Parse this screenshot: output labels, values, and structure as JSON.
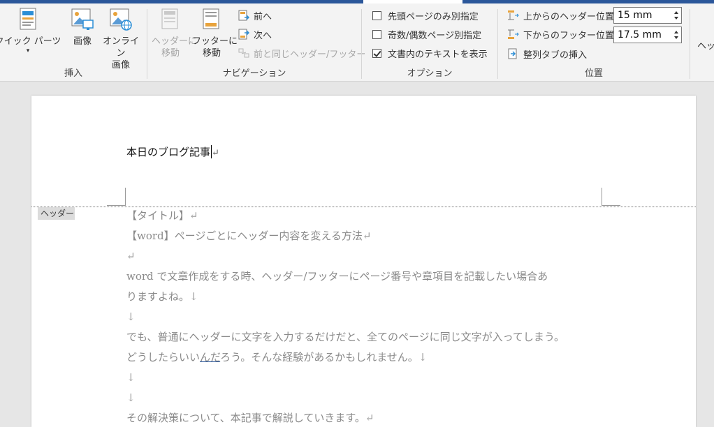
{
  "ribbon": {
    "insert_group": {
      "label": "挿入",
      "quick_parts": "クイック パーツ",
      "quick_parts_arrow": "▾",
      "picture": "画像",
      "online_picture_line1": "オンライン",
      "online_picture_line2": "画像"
    },
    "navigation_group": {
      "label": "ナビゲーション",
      "goto_header_line1": "ヘッダーに",
      "goto_header_line2": "移動",
      "goto_footer_line1": "フッターに",
      "goto_footer_line2": "移動",
      "previous": "前へ",
      "next": "次へ",
      "link_to_previous": "前と同じヘッダー/フッター"
    },
    "options_group": {
      "label": "オプション",
      "different_first_page": "先頭ページのみ別指定",
      "different_first_page_checked": false,
      "different_odd_even": "奇数/偶数ページ別指定",
      "different_odd_even_checked": false,
      "show_document_text": "文書内のテキストを表示",
      "show_document_text_checked": true
    },
    "position_group": {
      "label": "位置",
      "header_from_top": "上からのヘッダー位置:",
      "header_from_top_value": "15 mm",
      "footer_from_bottom": "下からのフッター位置:",
      "footer_from_bottom_value": "17.5 mm",
      "insert_alignment_tab": "整列タブの挿入"
    },
    "close_group": {
      "label_partial": "ヘッダー"
    }
  },
  "document": {
    "header_text": "本日のブログ記事",
    "header_mark": "↵",
    "header_tag": "ヘッダー",
    "lines": [
      {
        "text": "【タイトル】",
        "mark": "↵"
      },
      {
        "text": "【word】ページごとにヘッダー内容を変える方法",
        "mark": "↵"
      },
      {
        "text": "",
        "mark": "↵"
      },
      {
        "text": "word で文章作成をする時、ヘッダー/フッターにページ番号や章項目を記載したい場合あ",
        "mark": ""
      },
      {
        "text": "りますよね。",
        "mark": "↓"
      },
      {
        "text": "",
        "mark": "↓"
      },
      {
        "text": "でも、普通にヘッダーに文字を入力するだけだと、全てのページに同じ文字が入ってしまう。",
        "mark": ""
      },
      {
        "text_pre": "どうしたらいい",
        "text_ul": "んだ",
        "text_post": "ろう。そんな経験があるかもしれません。",
        "mark": "↓"
      },
      {
        "text": "",
        "mark": "↓"
      },
      {
        "text": "",
        "mark": "↓"
      },
      {
        "text": "その解決策について、本記事で解説していきます。",
        "mark": "↵"
      }
    ]
  }
}
